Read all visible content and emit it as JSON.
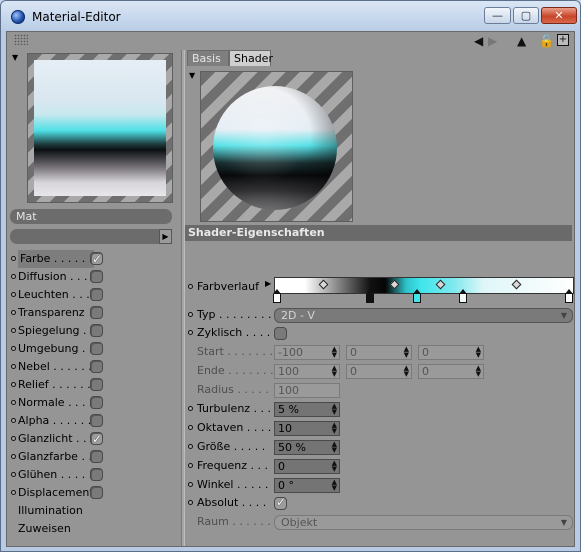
{
  "window": {
    "title": "Material-Editor"
  },
  "material": {
    "name": "Mat"
  },
  "channels": [
    {
      "label": "Farbe . . . . . .",
      "checked": true
    },
    {
      "label": "Diffusion . . . .",
      "checked": false
    },
    {
      "label": "Leuchten . . . .",
      "checked": false
    },
    {
      "label": "Transparenz",
      "checked": false
    },
    {
      "label": "Spiegelung . .",
      "checked": false
    },
    {
      "label": "Umgebung . . .",
      "checked": false
    },
    {
      "label": "Nebel . . . . . .",
      "checked": false
    },
    {
      "label": "Relief . . . . . .",
      "checked": false
    },
    {
      "label": "Normale . . . .",
      "checked": false
    },
    {
      "label": "Alpha . . . . . .",
      "checked": false
    },
    {
      "label": "Glanzlicht . . .",
      "checked": true
    },
    {
      "label": "Glanzfarbe . . .",
      "checked": false
    },
    {
      "label": "Glühen . . . . .",
      "checked": false
    },
    {
      "label": "Displacement",
      "checked": false
    }
  ],
  "extra_items": [
    "Illumination",
    "Zuweisen"
  ],
  "tabs": [
    "Basis",
    "Shader"
  ],
  "section_title": "Shader-Eigenschaften",
  "params": {
    "farbverlauf": "Farbverlauf",
    "typ_label": "Typ . . . . . . . . .",
    "typ_value": "2D - V",
    "zyklisch_label": "Zyklisch . . . .",
    "start_label": "Start . . . . . . .",
    "start_values": [
      "-100",
      "0",
      "0"
    ],
    "ende_label": "Ende . . . . . . .",
    "ende_values": [
      "100",
      "0",
      "0"
    ],
    "radius_label": "Radius . . . . .",
    "radius_value": "100",
    "turbulenz_label": "Turbulenz . . .",
    "turbulenz_value": "5 %",
    "oktaven_label": "Oktaven . . . .",
    "oktaven_value": "10",
    "groesse_label": "Größe . . . . .",
    "groesse_value": "50 %",
    "frequenz_label": "Frequenz . . .",
    "frequenz_value": "0",
    "winkel_label": "Winkel . . . . .",
    "winkel_value": "0 °",
    "absolut_label": "Absolut . . . .",
    "raum_label": "Raum . . . . . .",
    "raum_value": "Objekt"
  }
}
